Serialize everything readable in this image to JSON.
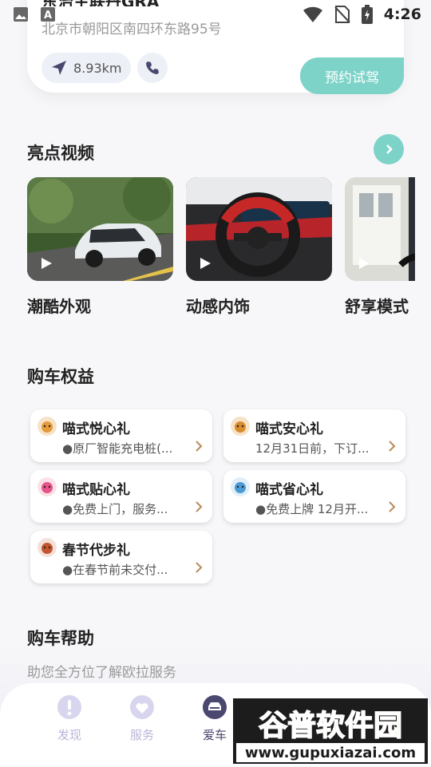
{
  "status_bar": {
    "time": "4:26"
  },
  "dealer": {
    "name": "东治主联丹GRA",
    "address": "北京市朝阳区南四环东路95号",
    "distance": "8.93km",
    "book_button": "预约试驾"
  },
  "videos": {
    "title": "亮点视频",
    "items": [
      {
        "label": "潮酷外观"
      },
      {
        "label": "动感内饰"
      },
      {
        "label": "舒享模式"
      }
    ]
  },
  "benefits": {
    "title": "购车权益",
    "items": [
      {
        "title": "喵式悦心礼",
        "desc": "●原厂智能充电桩(..."
      },
      {
        "title": "喵式安心礼",
        "desc": "12月31日前，下订..."
      },
      {
        "title": "喵式贴心礼",
        "desc": "●免费上门，服务..."
      },
      {
        "title": "喵式省心礼",
        "desc": "●免费上牌 12月开..."
      },
      {
        "title": "春节代步礼",
        "desc": "●在春节前未交付..."
      }
    ]
  },
  "help": {
    "title": "购车帮助",
    "subtitle": "助您全方位了解欧拉服务"
  },
  "tabbar": {
    "items": [
      {
        "label": "发现"
      },
      {
        "label": "服务"
      },
      {
        "label": "爱车"
      }
    ]
  },
  "watermark": {
    "line1": "谷普软件园",
    "line2": "www.gupuxiazai.com"
  },
  "colors": {
    "accent": "#7dd3c8",
    "tab_active": "#4b4870",
    "tab_inactive": "#b8b6d9"
  }
}
